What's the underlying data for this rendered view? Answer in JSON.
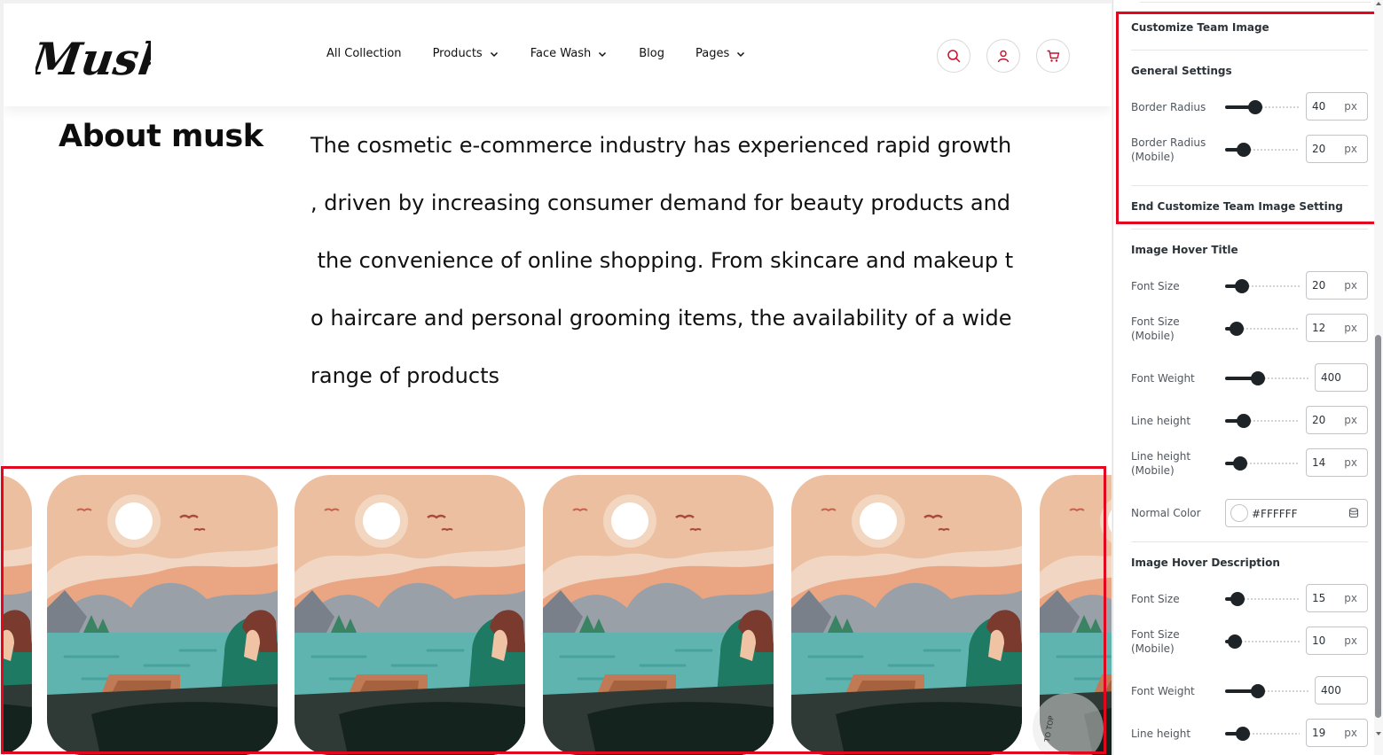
{
  "header": {
    "logo_text": "Musk",
    "nav": [
      {
        "label": "All Collection",
        "has_dropdown": false
      },
      {
        "label": "Products",
        "has_dropdown": true
      },
      {
        "label": "Face Wash",
        "has_dropdown": true
      },
      {
        "label": "Blog",
        "has_dropdown": false
      },
      {
        "label": "Pages",
        "has_dropdown": true
      }
    ],
    "icons": [
      "search-icon",
      "user-icon",
      "cart-icon"
    ],
    "accent_color": "#c8102e"
  },
  "about": {
    "title": "About musk",
    "lines": [
      "The cosmetic e-commerce industry has experienced rapid growth",
      ", driven by increasing consumer demand for beauty products and",
      " the convenience of online shopping. From skincare and makeup t",
      "o haircare and personal grooming items, the availability of a wide",
      "range of products"
    ]
  },
  "gallery": {
    "image_count": 6,
    "scroll_top_text": "TO TOP",
    "highlight_color": "#e3061e"
  },
  "panel": {
    "customize_team_image": {
      "title": "Customize Team Image",
      "general_settings": "General Settings",
      "border_radius": {
        "label": "Border Radius",
        "value": "40",
        "unit": "px",
        "level": 0.4
      },
      "border_radius_mobile": {
        "label": "Border Radius",
        "label2": "(Mobile)",
        "value": "20",
        "unit": "px",
        "level": 0.25
      },
      "end_label": "End Customize Team Image Setting"
    },
    "image_hover_title": {
      "title": "Image Hover Title",
      "font_size": {
        "label": "Font Size",
        "value": "20",
        "unit": "px",
        "level": 0.23
      },
      "font_size_mobile": {
        "label": "Font Size",
        "label2": "(Mobile)",
        "value": "12",
        "unit": "px",
        "level": 0.15
      },
      "font_weight": {
        "label": "Font Weight",
        "value": "400",
        "level": 0.39
      },
      "line_height": {
        "label": "Line height",
        "value": "20",
        "unit": "px",
        "level": 0.25
      },
      "line_height_mobile": {
        "label": "Line height",
        "label2": "(Mobile)",
        "value": "14",
        "unit": "px",
        "level": 0.2
      },
      "normal_color": {
        "label": "Normal Color",
        "value": "#FFFFFF"
      }
    },
    "image_hover_description": {
      "title": "Image Hover Description",
      "font_size": {
        "label": "Font Size",
        "value": "15",
        "unit": "px",
        "level": 0.17
      },
      "font_size_mobile": {
        "label": "Font Size",
        "label2": "(Mobile)",
        "value": "10",
        "unit": "px",
        "level": 0.13
      },
      "font_weight": {
        "label": "Font Weight",
        "value": "400",
        "level": 0.39
      },
      "line_height": {
        "label": "Line height",
        "value": "19",
        "unit": "px",
        "level": 0.24
      }
    }
  }
}
